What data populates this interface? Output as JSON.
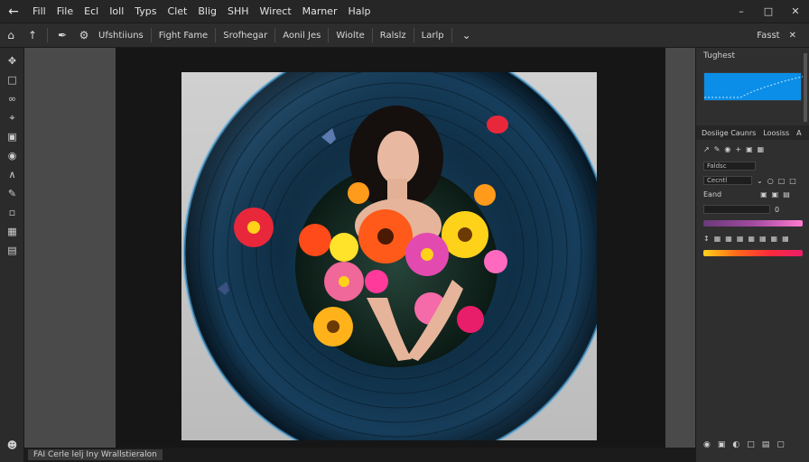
{
  "menubar": {
    "icon": "back-arrow-icon",
    "items": [
      "Fill",
      "File",
      "Ecl",
      "Ioll",
      "Typs",
      "Clet",
      "Blig",
      "SHH",
      "Wirect",
      "Marner",
      "Halp"
    ],
    "window_controls": [
      "–",
      "□",
      "✕"
    ]
  },
  "optbar": {
    "buttons": [
      "Ufshtiiuns",
      "Fight Fame",
      "Srofhegar",
      "Aonil Jes",
      "Wiolte",
      "Ralslz",
      "Larlp"
    ],
    "right_labels": [
      "Fasst",
      "✕"
    ]
  },
  "toolbar": {
    "tools": [
      "move-icon",
      "marquee-icon",
      "lasso-icon",
      "crop-icon",
      "frame-icon",
      "eyedropper-icon",
      "pen-icon",
      "brush-icon",
      "eraser-icon",
      "type-icon",
      "shape-icon"
    ]
  },
  "statusbar": {
    "text": "FAI Cerle lelj Iny Wrallstieralon"
  },
  "rightpanel": {
    "title": "Tughest",
    "tabs": [
      "Dosiige Caunrs",
      "Loosiss",
      "A"
    ],
    "field_1": "Faldsc",
    "field_2": "Cecntl",
    "label_1": "Eand",
    "value_1": "0"
  },
  "colors": {
    "histogram": "#0a8ee8",
    "gradient_1": "#7a3a8a",
    "gradient_2": "#ff3030"
  }
}
